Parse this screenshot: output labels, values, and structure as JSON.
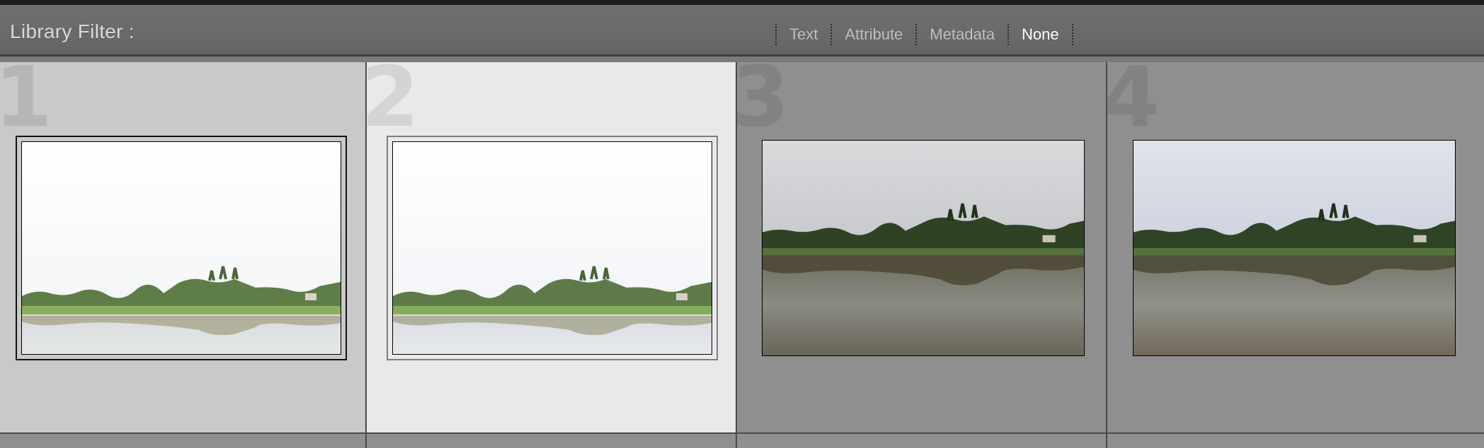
{
  "filter_bar": {
    "title": "Library Filter :",
    "tabs": [
      {
        "label": "Text",
        "active": false
      },
      {
        "label": "Attribute",
        "active": false
      },
      {
        "label": "Metadata",
        "active": false
      },
      {
        "label": "None",
        "active": true
      }
    ]
  },
  "grid": {
    "cells": [
      {
        "index": "1",
        "state": "selected",
        "background": "#c9c9c9",
        "edit": "overexposed"
      },
      {
        "index": "2",
        "state": "primary-selected",
        "background": "#e9e9e9",
        "edit": "overexposed"
      },
      {
        "index": "3",
        "state": "unselected",
        "background": "#8f8f8f",
        "edit": "original"
      },
      {
        "index": "4",
        "state": "unselected",
        "background": "#8f8f8f",
        "edit": "original"
      }
    ]
  },
  "colors": {
    "filter_bar": "#6c6c6c",
    "active_tab": "#ffffff",
    "inactive_tab": "#c0c0c0"
  }
}
